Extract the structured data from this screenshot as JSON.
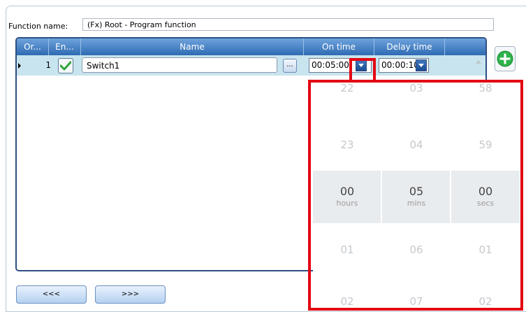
{
  "function_name": {
    "label": "Function name:",
    "value": "(Fx) Root - Program function"
  },
  "grid": {
    "columns": [
      "Or...",
      "En...",
      "Name",
      "On time",
      "Delay time"
    ],
    "rows": [
      {
        "order": "1",
        "enabled": true,
        "name": "Switch1",
        "browse_label": "...",
        "on_time": "00:05:00",
        "delay_time": "00:00:10"
      }
    ]
  },
  "nav": {
    "prev_label": "<<<",
    "next_label": ">>>"
  },
  "picker": {
    "hours": {
      "above2": "22",
      "above1": "23",
      "selected": "00",
      "below1": "01",
      "below2": "02",
      "unit": "hours"
    },
    "mins": {
      "above2": "03",
      "above1": "04",
      "selected": "05",
      "below1": "06",
      "below2": "07",
      "unit": "mins"
    },
    "secs": {
      "above2": "58",
      "above1": "59",
      "selected": "00",
      "below1": "01",
      "below2": "02",
      "unit": "secs"
    }
  },
  "colors": {
    "header": "#2f6bb3",
    "selected_row": "#c8e4ee",
    "highlight": "#e30613",
    "add_icon": "#2db34a"
  },
  "icons": {
    "enabled": "checkmark-icon",
    "add": "add-icon",
    "dropdown": "chevron-down-icon"
  }
}
